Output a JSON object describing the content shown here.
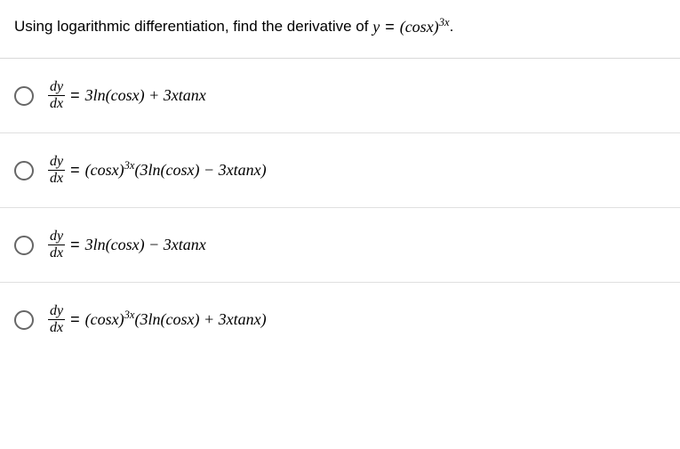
{
  "question": {
    "prompt_prefix": "Using logarithmic differentiation, find the derivative of ",
    "equation_lhs": "y",
    "equation_eq": "=",
    "equation_rhs_base": "(cosx)",
    "equation_rhs_exp": "3x",
    "period": "."
  },
  "frac": {
    "num": "dy",
    "den": "dx"
  },
  "options": [
    {
      "eq": "=",
      "rhs_plain": "3ln(cosx) + 3xtanx"
    },
    {
      "eq": "=",
      "rhs_base": "(cosx)",
      "rhs_exp": "3x",
      "rhs_tail": "(3ln(cosx) − 3xtanx)"
    },
    {
      "eq": "=",
      "rhs_plain": "3ln(cosx) − 3xtanx"
    },
    {
      "eq": "=",
      "rhs_base": "(cosx)",
      "rhs_exp": "3x",
      "rhs_tail": "(3ln(cosx) + 3xtanx)"
    }
  ]
}
